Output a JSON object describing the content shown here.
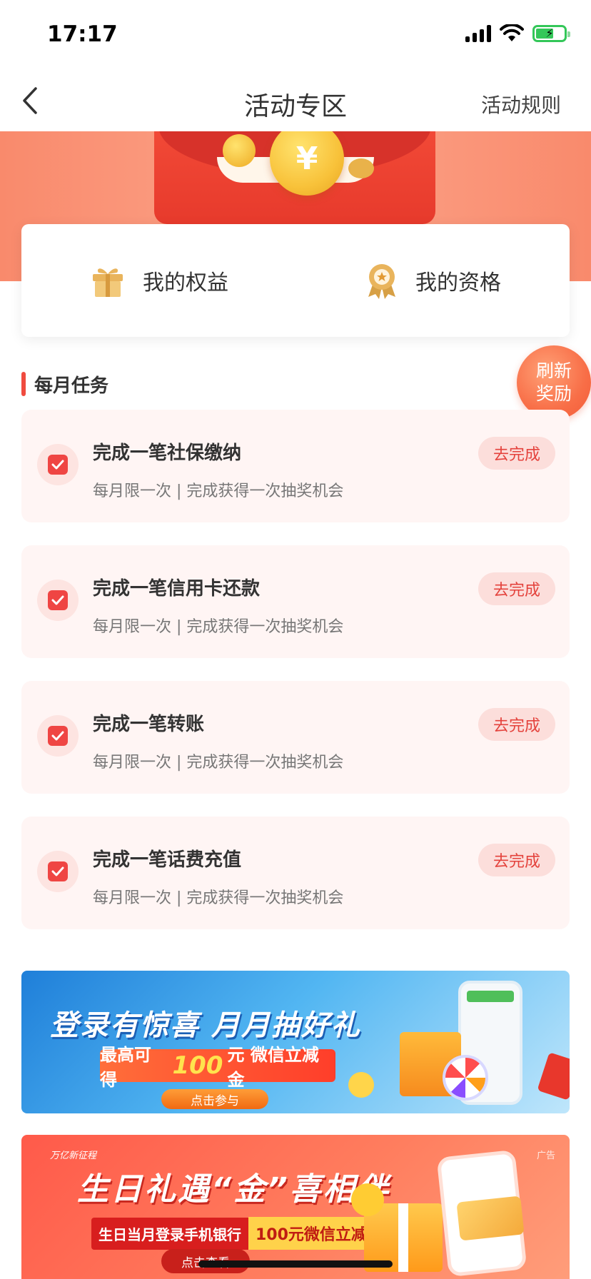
{
  "status": {
    "time": "17:17"
  },
  "nav": {
    "title": "活动专区",
    "rules_label": "活动规则"
  },
  "benefits": [
    {
      "label": "我的权益"
    },
    {
      "label": "我的资格"
    }
  ],
  "section": {
    "title": "每月任务"
  },
  "refresh": {
    "line1": "刷新",
    "line2": "奖励"
  },
  "tasks": [
    {
      "title": "完成一笔社保缴纳",
      "subtitle": "每月限一次 | 完成获得一次抽奖机会",
      "button": "去完成"
    },
    {
      "title": "完成一笔信用卡还款",
      "subtitle": "每月限一次 | 完成获得一次抽奖机会",
      "button": "去完成"
    },
    {
      "title": "完成一笔转账",
      "subtitle": "每月限一次 | 完成获得一次抽奖机会",
      "button": "去完成"
    },
    {
      "title": "完成一笔话费充值",
      "subtitle": "每月限一次 | 完成获得一次抽奖机会",
      "button": "去完成"
    }
  ],
  "banner1": {
    "headline": "登录有惊喜 月月抽好礼",
    "promo_prefix": "最高可得",
    "promo_amount": "100",
    "promo_suffix": "元 微信立减金",
    "button": "点击参与"
  },
  "banner2": {
    "tag": "万亿新征程",
    "headline": "生日礼遇“金”喜相伴",
    "pill_left": "生日当月登录手机银行",
    "pill_right": "100元微信立减金",
    "button": "点击查看",
    "ad_label": "广告"
  },
  "colors": {
    "accent": "#f04b3f",
    "task_bg": "#fff5f4",
    "button_bg": "#fcdedb",
    "hero": "#fba58b"
  }
}
